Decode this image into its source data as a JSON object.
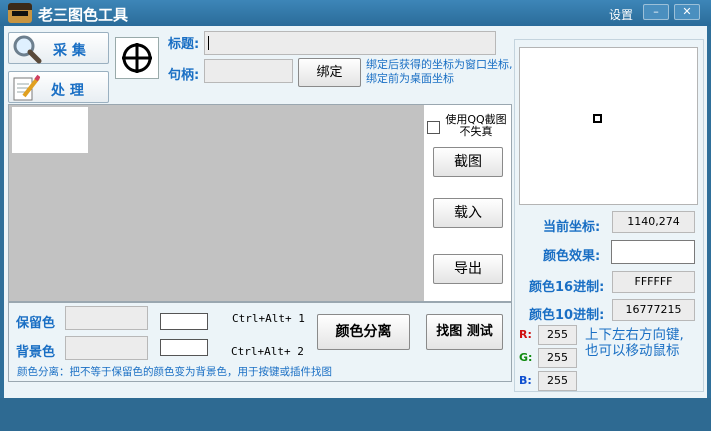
{
  "window": {
    "title": "老三图色工具",
    "settings_label": "设置",
    "minimize_glyph": "–",
    "close_glyph": "✕"
  },
  "left_buttons": {
    "collect_label": "采 集",
    "process_label": "处 理"
  },
  "bind": {
    "title_label": "标题:",
    "title_value": "",
    "handle_label": "句柄:",
    "handle_value": "",
    "bind_button": "绑定",
    "bind_note": "绑定后获得的坐标为窗口坐标, 绑定前为桌面坐标"
  },
  "capture": {
    "qq_checkbox_label": "使用QQ截图不失真",
    "qq_checked": false,
    "screenshot_button": "截图",
    "load_button": "载入",
    "export_button": "导出"
  },
  "colors": {
    "keep_label": "保留色",
    "background_label": "背景色",
    "keep_hotkey": "Ctrl+Alt+ 1",
    "background_hotkey": "Ctrl+Alt+ 2",
    "separate_button": "颜色分离",
    "find_test_button": "找图 测试",
    "hint": "颜色分离：把不等于保留色的颜色变为背景色，用于按键或插件找图"
  },
  "info": {
    "coord_label": "当前坐标:",
    "coord_value": "1140,274",
    "effect_label": "颜色效果:",
    "hex_label": "颜色16进制:",
    "hex_value": "FFFFFF",
    "dec_label": "颜色10进制:",
    "dec_value": "16777215",
    "r_label": "R:",
    "r_value": "255",
    "g_label": "G:",
    "g_value": "255",
    "b_label": "B:",
    "b_value": "255",
    "arrow_hint": "上下左右方向键, 也可以移动鼠标"
  },
  "theme": {
    "accent": "#1a6fc4",
    "title_bar": "#2a6b99",
    "r_color": "#d01010",
    "g_color": "#108a10",
    "b_color": "#1050d0"
  }
}
